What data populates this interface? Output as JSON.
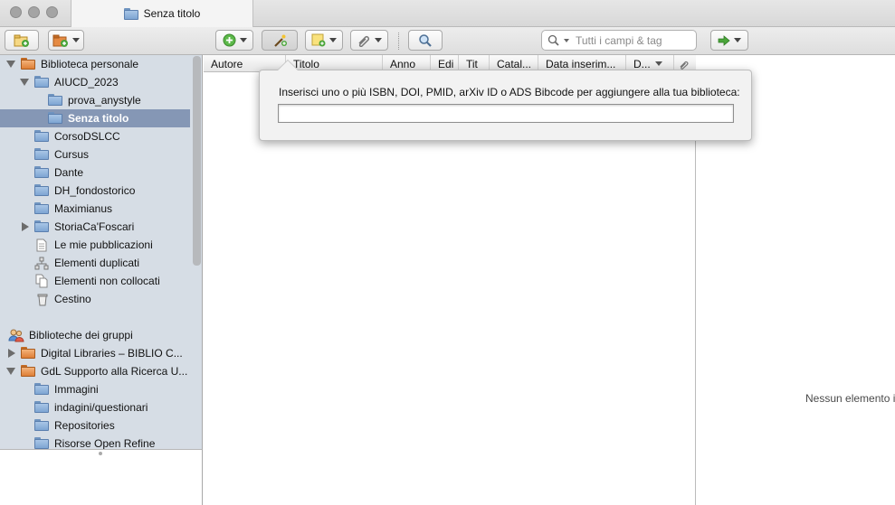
{
  "window": {
    "tab_title": "Senza titolo"
  },
  "toolbar": {
    "search_placeholder": "Tutti i campi & tag"
  },
  "sidebar": {
    "items": [
      {
        "label": "Biblioteca personale"
      },
      {
        "label": "AIUCD_2023"
      },
      {
        "label": "prova_anystyle"
      },
      {
        "label": "Senza titolo"
      },
      {
        "label": "CorsoDSLCC"
      },
      {
        "label": "Cursus"
      },
      {
        "label": "Dante"
      },
      {
        "label": "DH_fondostorico"
      },
      {
        "label": "Maximianus"
      },
      {
        "label": "StoriaCa'Foscari"
      },
      {
        "label": "Le mie pubblicazioni"
      },
      {
        "label": "Elementi duplicati"
      },
      {
        "label": "Elementi non collocati"
      },
      {
        "label": "Cestino"
      }
    ],
    "groups_header": "Biblioteche dei gruppi",
    "groups": [
      {
        "label": "Digital Libraries – BIBLIO C..."
      },
      {
        "label": "GdL Supporto alla Ricerca U..."
      },
      {
        "label": "Immagini"
      },
      {
        "label": "indagini/questionari"
      },
      {
        "label": "Repositories"
      },
      {
        "label": "Risorse Open Refine"
      }
    ]
  },
  "items_table": {
    "columns": [
      "Autore",
      "Titolo",
      "Anno",
      "Edi",
      "Tit",
      "Catal...",
      "Data inserim...",
      "D..."
    ]
  },
  "item_pane": {
    "empty_message": "Nessun elemento i"
  },
  "popup": {
    "label": "Inserisci uno o più ISBN, DOI, PMID, arXiv ID o ADS Bibcode per aggiungere alla tua biblioteca:",
    "value": ""
  }
}
